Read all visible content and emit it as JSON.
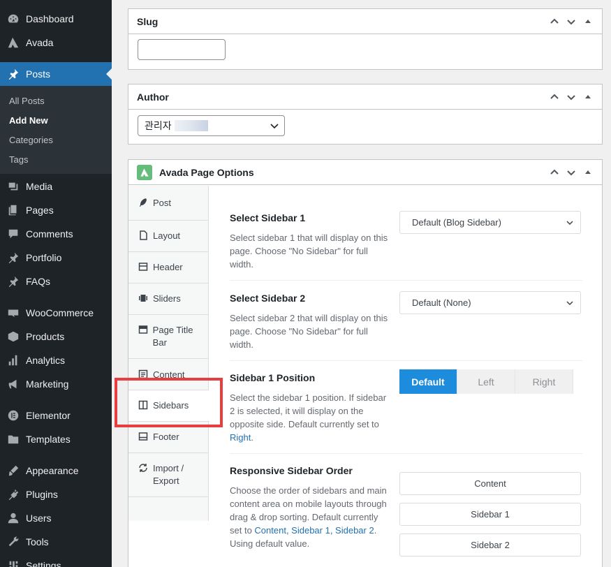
{
  "sidebar": {
    "menu": [
      {
        "label": "Dashboard",
        "icon": "dashboard-icon"
      },
      {
        "label": "Avada",
        "icon": "avada-icon"
      },
      {
        "label": "Posts",
        "icon": "pin-icon"
      },
      {
        "label": "Media",
        "icon": "media-icon"
      },
      {
        "label": "Pages",
        "icon": "pages-icon"
      },
      {
        "label": "Comments",
        "icon": "comments-icon"
      },
      {
        "label": "Portfolio",
        "icon": "pin-icon"
      },
      {
        "label": "FAQs",
        "icon": "pin-icon"
      },
      {
        "label": "WooCommerce",
        "icon": "woo-icon"
      },
      {
        "label": "Products",
        "icon": "products-icon"
      },
      {
        "label": "Analytics",
        "icon": "analytics-icon"
      },
      {
        "label": "Marketing",
        "icon": "megaphone-icon"
      },
      {
        "label": "Elementor",
        "icon": "elementor-icon"
      },
      {
        "label": "Templates",
        "icon": "folder-icon"
      },
      {
        "label": "Appearance",
        "icon": "brush-icon"
      },
      {
        "label": "Plugins",
        "icon": "plugin-icon"
      },
      {
        "label": "Users",
        "icon": "user-icon"
      },
      {
        "label": "Tools",
        "icon": "wrench-icon"
      },
      {
        "label": "Settings",
        "icon": "settings-icon"
      }
    ],
    "posts_submenu": [
      "All Posts",
      "Add New",
      "Categories",
      "Tags"
    ]
  },
  "slug_box": {
    "title": "Slug",
    "value": ""
  },
  "author_box": {
    "title": "Author",
    "selected": "관리자"
  },
  "avada": {
    "title": "Avada Page Options",
    "tabs": [
      {
        "label": "Post",
        "icon": "feather-icon"
      },
      {
        "label": "Layout",
        "icon": "document-icon"
      },
      {
        "label": "Header",
        "icon": "header-icon"
      },
      {
        "label": "Sliders",
        "icon": "slider-icon"
      },
      {
        "label": "Page Title Bar",
        "icon": "titlebar-icon"
      },
      {
        "label": "Content",
        "icon": "content-icon"
      },
      {
        "label": "Sidebars",
        "icon": "sidebar-icon"
      },
      {
        "label": "Footer",
        "icon": "footer-icon"
      },
      {
        "label": "Import / Export",
        "icon": "sync-icon"
      }
    ],
    "options": {
      "sidebar1": {
        "title": "Select Sidebar 1",
        "desc": "Select sidebar 1 that will display on this page. Choose \"No Sidebar\" for full width.",
        "value": "Default (Blog Sidebar)"
      },
      "sidebar2": {
        "title": "Select Sidebar 2",
        "desc": "Select sidebar 2 that will display on this page. Choose \"No Sidebar\" for full width.",
        "value": "Default (None)"
      },
      "position": {
        "title": "Sidebar 1 Position",
        "desc": "Select the sidebar 1 position. If sidebar 2 is selected, it will display on the opposite side. Default currently set to",
        "desc_link": "Right",
        "desc_end": ".",
        "buttons": [
          "Default",
          "Left",
          "Right"
        ],
        "active": "Default"
      },
      "order": {
        "title": "Responsive Sidebar Order",
        "desc": "Choose the order of sidebars and main content area on mobile layouts through drag & drop sorting. Default currently set to",
        "desc_link": "Content, Sidebar 1, Sidebar 2",
        "desc_end": ". Using default value.",
        "items": [
          "Content",
          "Sidebar 1",
          "Sidebar 2"
        ]
      }
    }
  },
  "colors": {
    "admin_bg": "#1d2327",
    "current_menu": "#2271b1",
    "avada_green": "#65bc7b",
    "active_button": "#1e8cdc",
    "highlight": "#e73f3f"
  }
}
